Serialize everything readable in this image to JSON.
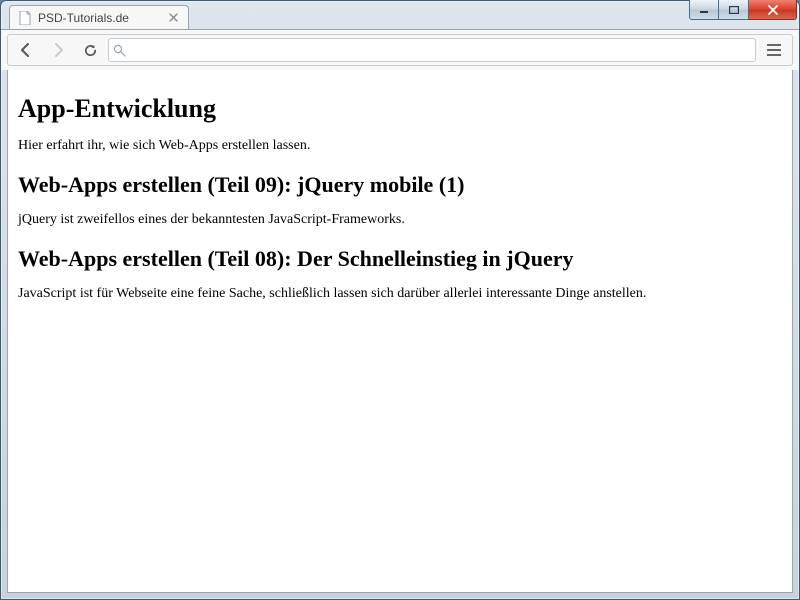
{
  "window": {
    "tab_title": "PSD-Tutorials.de"
  },
  "toolbar": {
    "url_value": ""
  },
  "page": {
    "heading": "App-Entwicklung",
    "intro": "Hier erfahrt ihr, wie sich Web-Apps erstellen lassen.",
    "articles": [
      {
        "title": "Web-Apps erstellen (Teil 09): jQuery mobile (1)",
        "text": "jQuery ist zweifellos eines der bekanntesten JavaScript-Frameworks."
      },
      {
        "title": "Web-Apps erstellen (Teil 08): Der Schnelleinstieg in jQuery",
        "text": "JavaScript ist für Webseite eine feine Sache, schließlich lassen sich darüber allerlei interessante Dinge anstellen."
      }
    ]
  }
}
